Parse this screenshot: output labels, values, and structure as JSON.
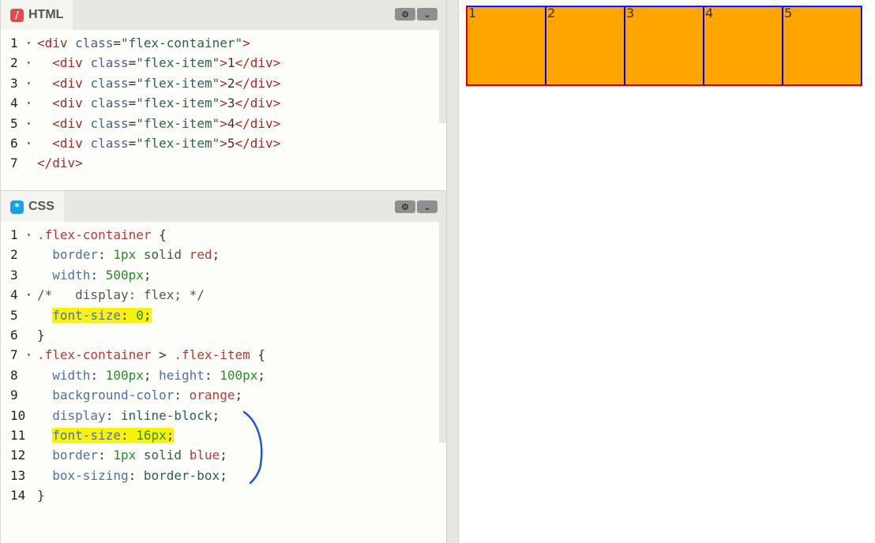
{
  "html_pane": {
    "title": "HTML",
    "icon": "html-slash-icon",
    "icon_glyph": "/",
    "icon_color": "#e84a4a",
    "lines": [
      {
        "num": "1",
        "fold": true,
        "tokens": [
          {
            "t": "<div",
            "c": "tag"
          },
          {
            "t": " "
          },
          {
            "t": "class",
            "c": "attr"
          },
          {
            "t": "=",
            "c": "punc"
          },
          {
            "t": "\"flex-container\"",
            "c": "str"
          },
          {
            "t": ">",
            "c": "tag"
          }
        ]
      },
      {
        "num": "2",
        "fold": true,
        "tokens": [
          {
            "t": "  "
          },
          {
            "t": "<div",
            "c": "tag"
          },
          {
            "t": " "
          },
          {
            "t": "class",
            "c": "attr"
          },
          {
            "t": "=",
            "c": "punc"
          },
          {
            "t": "\"flex-item\"",
            "c": "str"
          },
          {
            "t": ">",
            "c": "tag"
          },
          {
            "t": "1",
            "c": "punc"
          },
          {
            "t": "</div>",
            "c": "tag"
          }
        ]
      },
      {
        "num": "3",
        "fold": true,
        "tokens": [
          {
            "t": "  "
          },
          {
            "t": "<div",
            "c": "tag"
          },
          {
            "t": " "
          },
          {
            "t": "class",
            "c": "attr"
          },
          {
            "t": "=",
            "c": "punc"
          },
          {
            "t": "\"flex-item\"",
            "c": "str"
          },
          {
            "t": ">",
            "c": "tag"
          },
          {
            "t": "2",
            "c": "punc"
          },
          {
            "t": "</div>",
            "c": "tag"
          }
        ]
      },
      {
        "num": "4",
        "fold": true,
        "tokens": [
          {
            "t": "  "
          },
          {
            "t": "<div",
            "c": "tag"
          },
          {
            "t": " "
          },
          {
            "t": "class",
            "c": "attr"
          },
          {
            "t": "=",
            "c": "punc"
          },
          {
            "t": "\"flex-item\"",
            "c": "str"
          },
          {
            "t": ">",
            "c": "tag"
          },
          {
            "t": "3",
            "c": "punc"
          },
          {
            "t": "</div>",
            "c": "tag"
          }
        ]
      },
      {
        "num": "5",
        "fold": true,
        "tokens": [
          {
            "t": "  "
          },
          {
            "t": "<div",
            "c": "tag"
          },
          {
            "t": " "
          },
          {
            "t": "class",
            "c": "attr"
          },
          {
            "t": "=",
            "c": "punc"
          },
          {
            "t": "\"flex-item\"",
            "c": "str"
          },
          {
            "t": ">",
            "c": "tag"
          },
          {
            "t": "4",
            "c": "punc"
          },
          {
            "t": "</div>",
            "c": "tag"
          }
        ]
      },
      {
        "num": "6",
        "fold": true,
        "tokens": [
          {
            "t": "  "
          },
          {
            "t": "<div",
            "c": "tag"
          },
          {
            "t": " "
          },
          {
            "t": "class",
            "c": "attr"
          },
          {
            "t": "=",
            "c": "punc"
          },
          {
            "t": "\"flex-item\"",
            "c": "str"
          },
          {
            "t": ">",
            "c": "tag"
          },
          {
            "t": "5",
            "c": "punc"
          },
          {
            "t": "</div>",
            "c": "tag"
          }
        ]
      },
      {
        "num": "7",
        "fold": false,
        "tokens": [
          {
            "t": "</div>",
            "c": "tag"
          }
        ]
      }
    ]
  },
  "css_pane": {
    "title": "CSS",
    "icon": "css-asterisk-icon",
    "icon_glyph": "*",
    "icon_color": "#1ba1e2",
    "lines": [
      {
        "num": "1",
        "fold": true,
        "tokens": [
          {
            "t": ".flex-container",
            "c": "sel"
          },
          {
            "t": " "
          },
          {
            "t": "{",
            "c": "punc"
          }
        ]
      },
      {
        "num": "2",
        "fold": false,
        "tokens": [
          {
            "t": "  "
          },
          {
            "t": "border",
            "c": "prop"
          },
          {
            "t": ": ",
            "c": "punc"
          },
          {
            "t": "1px",
            "c": "num"
          },
          {
            "t": " "
          },
          {
            "t": "solid",
            "c": "kw"
          },
          {
            "t": " "
          },
          {
            "t": "red",
            "c": "col"
          },
          {
            "t": ";",
            "c": "punc"
          }
        ]
      },
      {
        "num": "3",
        "fold": false,
        "tokens": [
          {
            "t": "  "
          },
          {
            "t": "width",
            "c": "prop"
          },
          {
            "t": ": ",
            "c": "punc"
          },
          {
            "t": "500px",
            "c": "num"
          },
          {
            "t": ";",
            "c": "punc"
          }
        ]
      },
      {
        "num": "4",
        "fold": true,
        "tokens": [
          {
            "t": "/*   display: flex; */",
            "c": "cmt"
          }
        ]
      },
      {
        "num": "5",
        "fold": false,
        "tokens": [
          {
            "t": "  "
          },
          {
            "t": "font-size",
            "c": "prop",
            "hl": true
          },
          {
            "t": ": ",
            "c": "punc",
            "hl": true
          },
          {
            "t": "0",
            "c": "num",
            "hl": true
          },
          {
            "t": ";",
            "c": "punc",
            "hl": true
          }
        ]
      },
      {
        "num": "6",
        "fold": false,
        "tokens": [
          {
            "t": "}",
            "c": "punc"
          }
        ]
      },
      {
        "num": "7",
        "fold": true,
        "tokens": [
          {
            "t": ".flex-container",
            "c": "sel"
          },
          {
            "t": " "
          },
          {
            "t": ">",
            "c": "punc"
          },
          {
            "t": " "
          },
          {
            "t": ".flex-item",
            "c": "sel"
          },
          {
            "t": " "
          },
          {
            "t": "{",
            "c": "punc"
          }
        ]
      },
      {
        "num": "8",
        "fold": false,
        "tokens": [
          {
            "t": "  "
          },
          {
            "t": "width",
            "c": "prop"
          },
          {
            "t": ": ",
            "c": "punc"
          },
          {
            "t": "100px",
            "c": "num"
          },
          {
            "t": "; ",
            "c": "punc"
          },
          {
            "t": "height",
            "c": "prop"
          },
          {
            "t": ": ",
            "c": "punc"
          },
          {
            "t": "100px",
            "c": "num"
          },
          {
            "t": ";",
            "c": "punc"
          }
        ]
      },
      {
        "num": "9",
        "fold": false,
        "tokens": [
          {
            "t": "  "
          },
          {
            "t": "background-color",
            "c": "prop"
          },
          {
            "t": ": ",
            "c": "punc"
          },
          {
            "t": "orange",
            "c": "col"
          },
          {
            "t": ";",
            "c": "punc"
          }
        ]
      },
      {
        "num": "10",
        "fold": false,
        "tokens": [
          {
            "t": "  "
          },
          {
            "t": "display",
            "c": "prop"
          },
          {
            "t": ": ",
            "c": "punc"
          },
          {
            "t": "inline-block",
            "c": "kw"
          },
          {
            "t": ";",
            "c": "punc"
          }
        ]
      },
      {
        "num": "11",
        "fold": false,
        "tokens": [
          {
            "t": "  "
          },
          {
            "t": "font-size",
            "c": "prop",
            "hl": true
          },
          {
            "t": ": ",
            "c": "punc",
            "hl": true
          },
          {
            "t": "16px",
            "c": "num",
            "hl": true
          },
          {
            "t": ";",
            "c": "punc",
            "hl": true
          }
        ]
      },
      {
        "num": "12",
        "fold": false,
        "tokens": [
          {
            "t": "  "
          },
          {
            "t": "border",
            "c": "prop"
          },
          {
            "t": ": ",
            "c": "punc"
          },
          {
            "t": "1px",
            "c": "num"
          },
          {
            "t": " "
          },
          {
            "t": "solid",
            "c": "kw"
          },
          {
            "t": " "
          },
          {
            "t": "blue",
            "c": "col"
          },
          {
            "t": ";",
            "c": "punc"
          }
        ]
      },
      {
        "num": "13",
        "fold": false,
        "tokens": [
          {
            "t": "  "
          },
          {
            "t": "box-sizing",
            "c": "prop"
          },
          {
            "t": ": ",
            "c": "punc"
          },
          {
            "t": "border-box",
            "c": "kw"
          },
          {
            "t": ";",
            "c": "punc"
          }
        ]
      },
      {
        "num": "14",
        "fold": false,
        "tokens": [
          {
            "t": "}",
            "c": "punc"
          }
        ]
      }
    ]
  },
  "pane_buttons": {
    "settings_icon": "gear-icon",
    "collapse_icon": "chevron-down-icon"
  },
  "preview": {
    "items": [
      "1",
      "2",
      "3",
      "4",
      "5"
    ],
    "container_border_color": "red",
    "item_background": "orange",
    "item_border_color": "blue"
  },
  "annotations": {
    "bracket_color": "#1f55d6",
    "highlight_color": "#f9f20c"
  }
}
